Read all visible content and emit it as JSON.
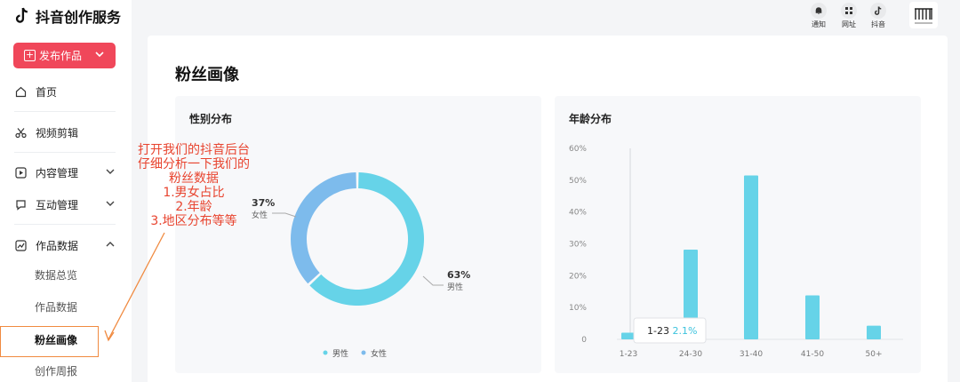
{
  "app": {
    "title": "抖音创作服务"
  },
  "sidebar": {
    "publish_label": "发布作品",
    "items": [
      {
        "label": "首页"
      },
      {
        "label": "视频剪辑"
      },
      {
        "label": "内容管理"
      },
      {
        "label": "互动管理"
      },
      {
        "label": "作品数据"
      }
    ],
    "subitems": [
      {
        "label": "数据总览"
      },
      {
        "label": "作品数据"
      },
      {
        "label": "粉丝画像"
      },
      {
        "label": "创作周报"
      }
    ]
  },
  "header": {
    "icons": [
      {
        "label": "通知",
        "icon": "bell-icon"
      },
      {
        "label": "网址",
        "icon": "grid-icon"
      },
      {
        "label": "抖音",
        "icon": "tiktok-icon"
      }
    ]
  },
  "main": {
    "title": "粉丝画像",
    "gender_panel_title": "性别分布",
    "age_panel_title": "年龄分布"
  },
  "annotation": {
    "lines": [
      "打开我们的抖音后台",
      "仔细分析一下我们的",
      "粉丝数据",
      "1.男女占比",
      "2.年龄",
      "3.地区分布等等"
    ]
  },
  "colors": {
    "accent": "#f0475a",
    "male": "#66d3e8",
    "female": "#7dbbec",
    "annotation": "#e8442f"
  },
  "gender_chart": {
    "type": "pie",
    "slices": [
      {
        "name": "男性",
        "value": 63,
        "pct_label": "63%"
      },
      {
        "name": "女性",
        "value": 37,
        "pct_label": "37%"
      }
    ],
    "legend": [
      "男性",
      "女性"
    ]
  },
  "chart_data": {
    "type": "bar",
    "categories": [
      "1-23",
      "24-30",
      "31-40",
      "41-50",
      "50+"
    ],
    "values": [
      2.1,
      28.2,
      51.5,
      13.8,
      4.3
    ],
    "ylim": [
      0,
      60
    ],
    "yticks": [
      "0",
      "10%",
      "20%",
      "30%",
      "40%",
      "50%",
      "60%"
    ],
    "tooltip": {
      "category": "1-23",
      "value": "2.1%"
    },
    "grid": false
  }
}
